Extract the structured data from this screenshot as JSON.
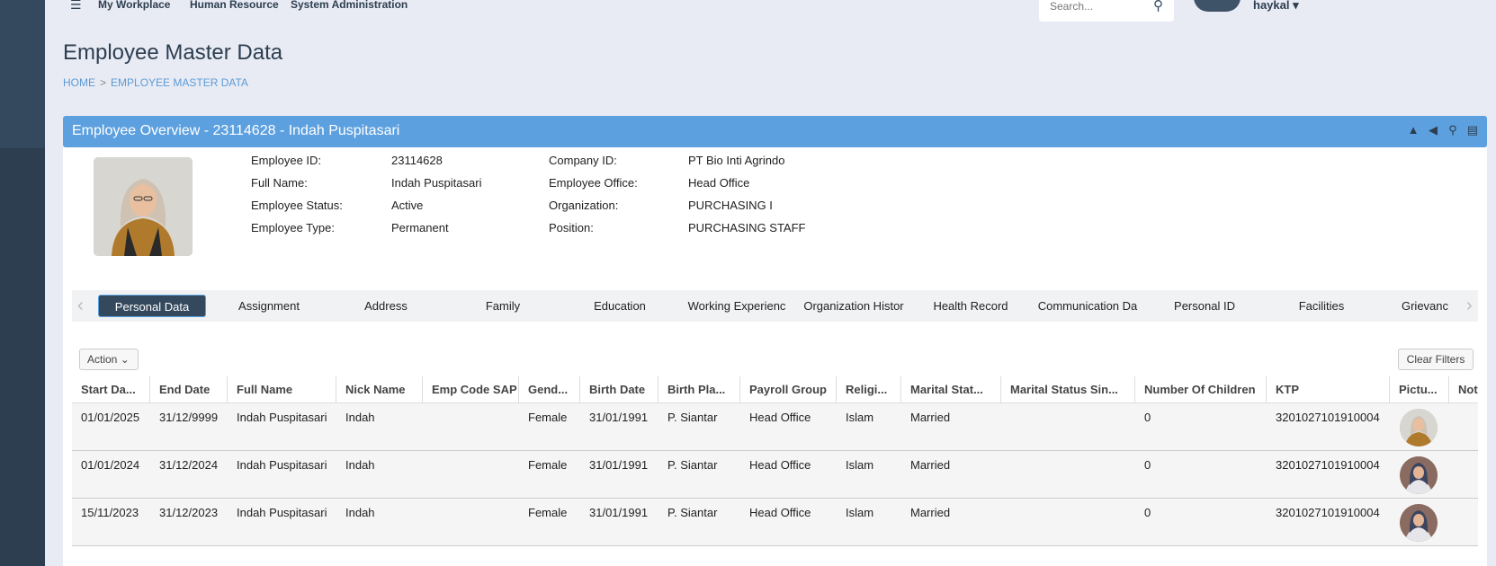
{
  "nav": {
    "items": [
      "My Workplace",
      "Human Resource",
      "System Administration"
    ],
    "search_placeholder": "Search...",
    "user": "haykal"
  },
  "page": {
    "title": "Employee Master Data",
    "breadcrumb": [
      "HOME",
      "EMPLOYEE MASTER DATA"
    ]
  },
  "panel": {
    "title": "Employee Overview - 23114628 - Indah Puspitasari"
  },
  "employee": {
    "left": [
      {
        "label": "Employee ID:",
        "value": "23114628"
      },
      {
        "label": "Full Name:",
        "value": "Indah Puspitasari"
      },
      {
        "label": "Employee Status:",
        "value": "Active"
      },
      {
        "label": "Employee Type:",
        "value": "Permanent"
      }
    ],
    "right": [
      {
        "label": "Company ID:",
        "value": "PT Bio Inti Agrindo"
      },
      {
        "label": "Employee Office:",
        "value": "Head Office"
      },
      {
        "label": "Organization:",
        "value": "PURCHASING I"
      },
      {
        "label": "Position:",
        "value": "PURCHASING STAFF"
      }
    ]
  },
  "tabs": [
    "Personal Data",
    "Assignment",
    "Address",
    "Family",
    "Education",
    "Working Experienc",
    "Organization Histor",
    "Health Record",
    "Communication Da",
    "Personal ID",
    "Facilities",
    "Grievanc"
  ],
  "toolbar": {
    "action": "Action",
    "clear": "Clear Filters"
  },
  "table": {
    "columns": [
      "Start Da...",
      "End Date",
      "Full Name",
      "Nick Name",
      "Emp Code SAP",
      "Gend...",
      "Birth Date",
      "Birth Pla...",
      "Payroll Group",
      "Religi...",
      "Marital Stat...",
      "Marital Status Sin...",
      "Number Of Children",
      "KTP",
      "Pictu...",
      "Not"
    ],
    "rows": [
      [
        "01/01/2025",
        "31/12/9999",
        "Indah Puspitasari",
        "Indah",
        "",
        "Female",
        "31/01/1991",
        "P. Siantar",
        "Head Office",
        "Islam",
        "Married",
        "",
        "0",
        "3201027101910004"
      ],
      [
        "01/01/2024",
        "31/12/2024",
        "Indah Puspitasari",
        "Indah",
        "",
        "Female",
        "31/01/1991",
        "P. Siantar",
        "Head Office",
        "Islam",
        "Married",
        "",
        "0",
        "3201027101910004"
      ],
      [
        "15/11/2023",
        "31/12/2023",
        "Indah Puspitasari",
        "Indah",
        "",
        "Female",
        "31/01/1991",
        "P. Siantar",
        "Head Office",
        "Islam",
        "Married",
        "",
        "0",
        "3201027101910004"
      ]
    ]
  }
}
